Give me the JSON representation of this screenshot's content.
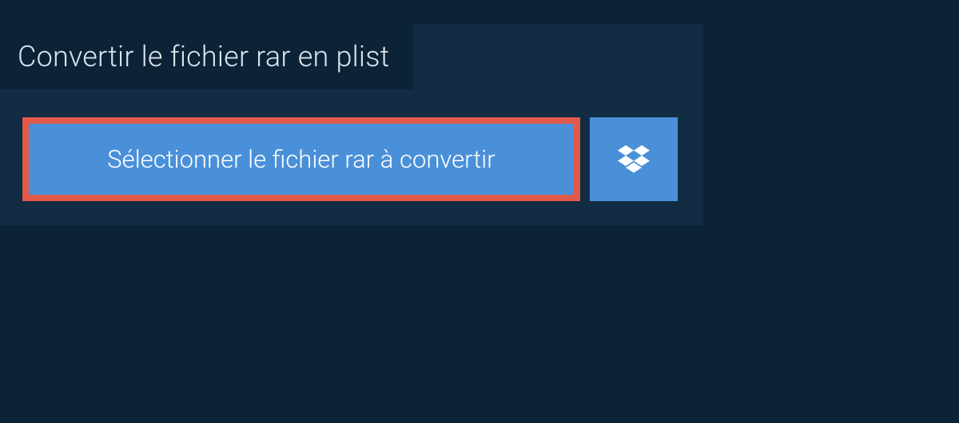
{
  "header": {
    "title": "Convertir le fichier rar en plist"
  },
  "actions": {
    "select_file_label": "Sélectionner le fichier rar à convertir"
  }
}
